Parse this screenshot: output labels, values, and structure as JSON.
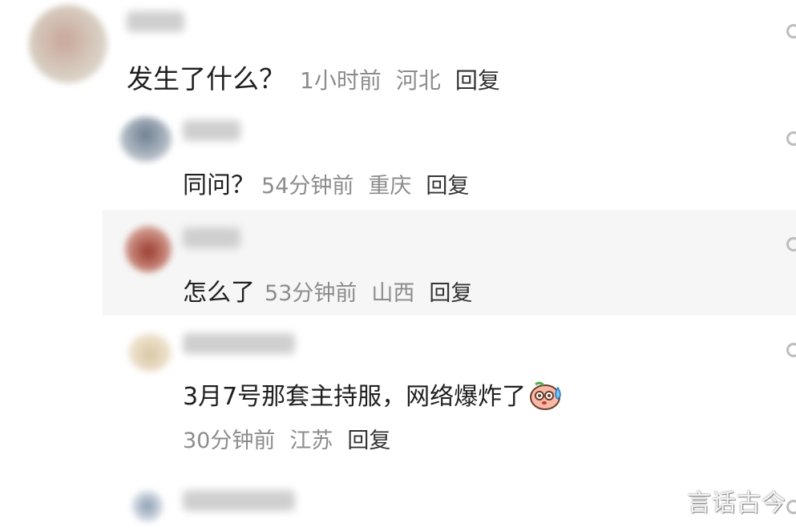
{
  "comments": [
    {
      "text": "发生了什么？",
      "time": "1小时前",
      "location": "河北",
      "reply_label": "回复"
    },
    {
      "text": "同问？",
      "time": "54分钟前",
      "location": "重庆",
      "reply_label": "回复"
    },
    {
      "text": "怎么了",
      "time": "53分钟前",
      "location": "山西",
      "reply_label": "回复"
    },
    {
      "text": "3月7号那套主持服，网络爆炸了",
      "emoji": "sweat-smile-emoji",
      "time": "30分钟前",
      "location": "江苏",
      "reply_label": "回复"
    }
  ],
  "watermark": "言话古今",
  "icons": [
    "more-icon",
    "avatar"
  ]
}
